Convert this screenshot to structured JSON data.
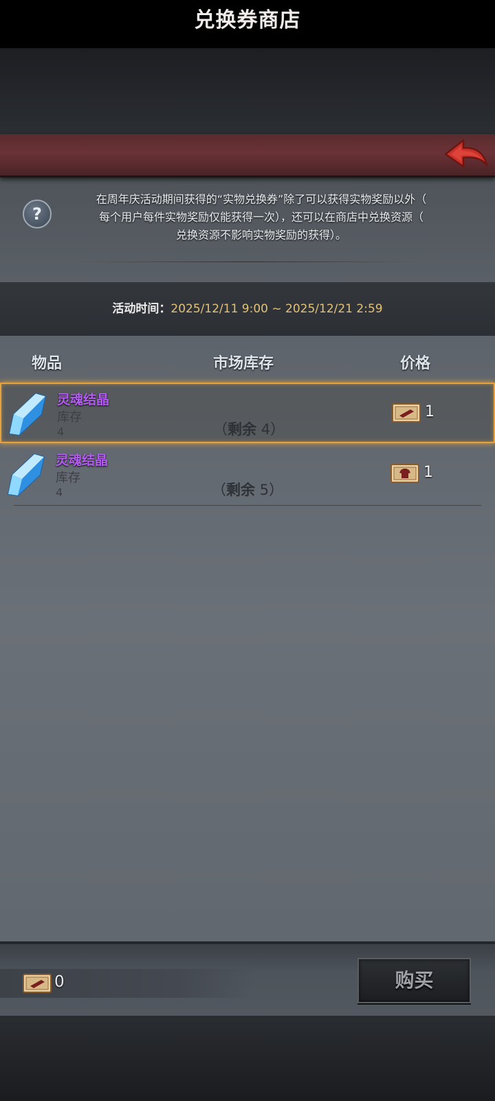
{
  "header": {
    "title": "兑换券商店",
    "back_icon": "red-back-arrow-icon"
  },
  "info": {
    "help_icon_glyph": "?",
    "lines": [
      "在周年庆活动期间获得的“实物兑换券”除了可以获得实物奖励以外（",
      "每个用户每件实物奖励仅能获得一次），还可以在商店中兑换资源（",
      "兑换资源不影响实物奖励的获得）。"
    ]
  },
  "event_time": {
    "label": "活动时间：",
    "value": "2025/12/11 9:00 ~ 2025/12/21 2:59"
  },
  "columns": {
    "item": "物品",
    "stock": "市场库存",
    "price": "价格"
  },
  "items": [
    {
      "name": "灵魂结晶",
      "stock_label": "库存",
      "stock_value": "4",
      "remain_open": "（",
      "remain_word": "剩余",
      "remain_value": "4",
      "remain_close": "）",
      "price": "1",
      "price_icon": "voucher-ticket-icon",
      "selected": true
    },
    {
      "name": "灵魂结晶",
      "stock_label": "库存",
      "stock_value": "4",
      "remain_open": "（",
      "remain_word": "剩余",
      "remain_value": "5",
      "remain_close": "）",
      "price": "1",
      "price_icon": "voucher-shirt-ticket-icon",
      "selected": false
    }
  ],
  "footer": {
    "balance": "0",
    "balance_icon": "voucher-ticket-icon",
    "buy_label": "购买"
  },
  "colors": {
    "header_bg": "#5a2b2e",
    "item_name": "#b35df0",
    "time_value": "#e2c27a",
    "selection_border": "#e6a23c",
    "back_arrow": "#c8322a"
  }
}
